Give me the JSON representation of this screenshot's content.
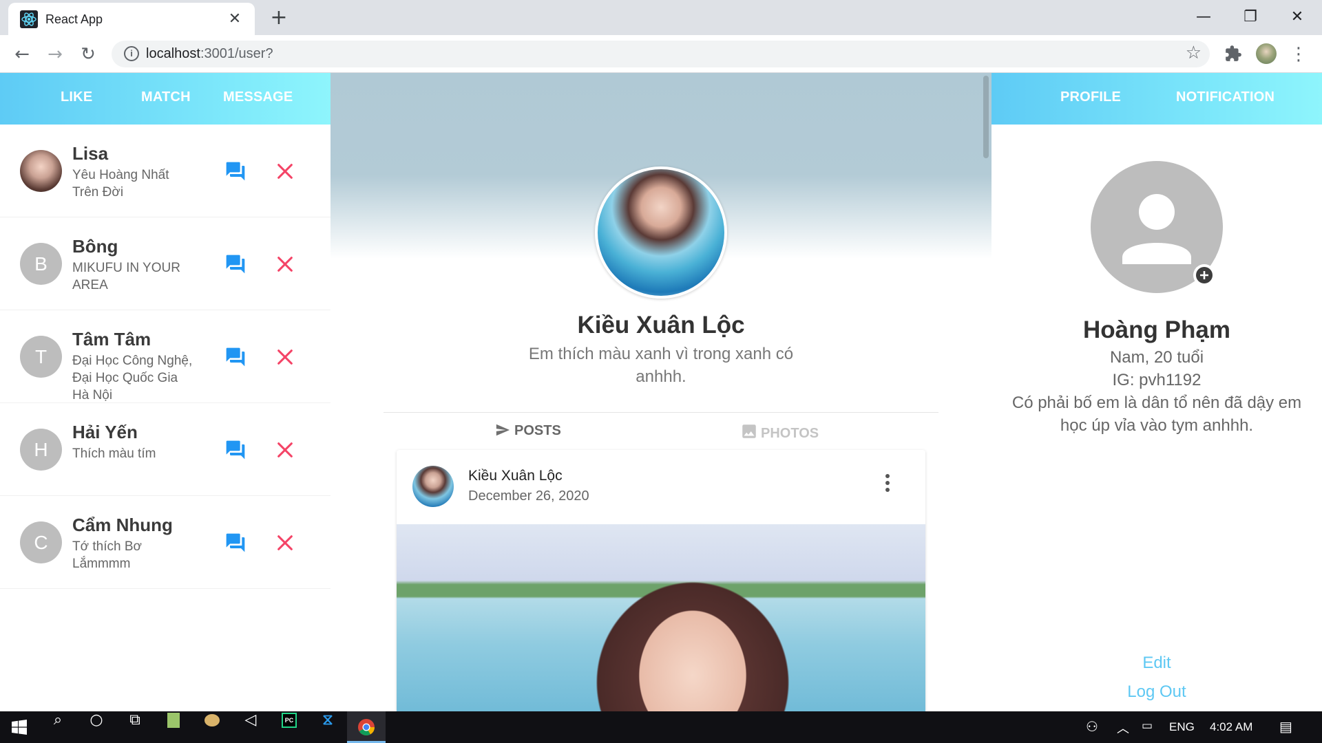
{
  "browser": {
    "tab_title": "React App",
    "tab_close": "✕",
    "new_tab": "+",
    "window_minimize": "—",
    "window_restore": "❐",
    "window_close": "✕",
    "url_host": "localhost",
    "url_rest": ":3001/user?"
  },
  "left_nav": {
    "like": "LIKE",
    "match": "MATCH",
    "message": "MESSAGE"
  },
  "matches": [
    {
      "name": "Lisa",
      "initial": "",
      "message": "Yêu Hoàng Nhất Trên Đời",
      "has_photo": true
    },
    {
      "name": "Bông",
      "initial": "B",
      "message": "MIKUFU IN YOUR AREA",
      "has_photo": false
    },
    {
      "name": "Tâm Tâm",
      "initial": "T",
      "message": "Đại Học Công Nghệ, Đại Học Quốc Gia Hà Nội",
      "has_photo": false
    },
    {
      "name": "Hải Yến",
      "initial": "H",
      "message": "Thích màu tím",
      "has_photo": false
    },
    {
      "name": "Cẩm Nhung",
      "initial": "C",
      "message": "Tớ thích Bơ Lắmmmm",
      "has_photo": false
    }
  ],
  "profile": {
    "name": "Kiều Xuân Lộc",
    "bio": "Em thích màu xanh vì trong xanh có anhhh."
  },
  "profile_tabs": {
    "posts": "POSTS",
    "photos": "PHOTOS",
    "active": "posts"
  },
  "post": {
    "author": "Kiều Xuân Lộc",
    "date": "December 26, 2020"
  },
  "right_nav": {
    "profile": "PROFILE",
    "notification": "NOTIFICATION"
  },
  "me": {
    "name": "Hoàng Phạm",
    "info": "Nam, 20 tuổi",
    "ig": "IG: pvh1192",
    "bio": "Có phải bố em là dân tổ nên đã dậy em học úp vỉa vào tym anhhh.",
    "edit": "Edit",
    "logout": "Log Out"
  },
  "taskbar": {
    "language": "ENG",
    "time": "4:02 AM"
  },
  "colors": {
    "nav_gradient_start": "#5ecbf5",
    "nav_gradient_end": "#8ef5fc",
    "chat_icon": "#2196f3",
    "remove_icon": "#f44366",
    "link": "#5ec8f3"
  }
}
